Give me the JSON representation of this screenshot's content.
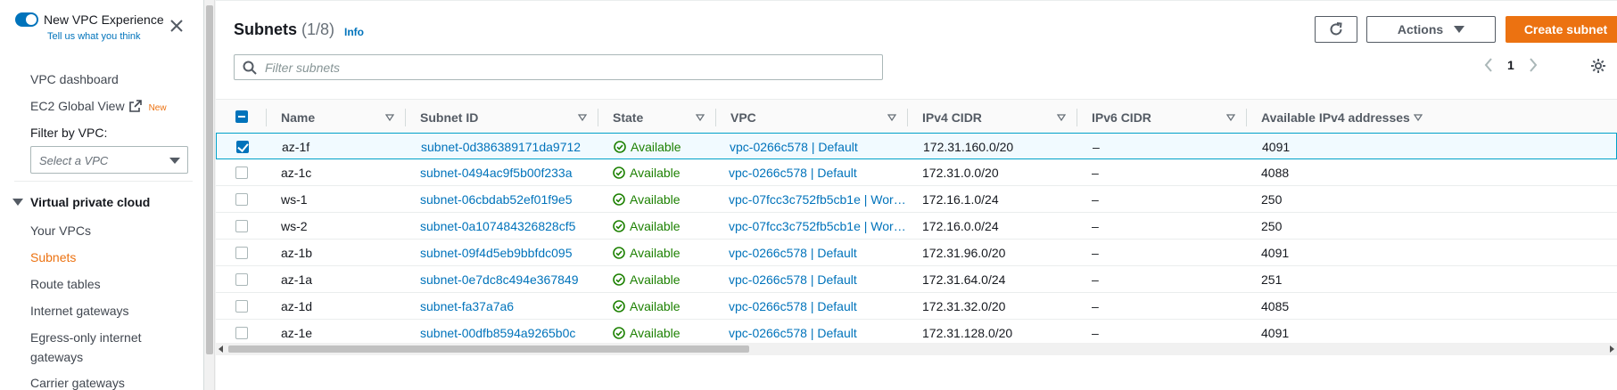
{
  "sidebar": {
    "toggle_label": "New VPC Experience",
    "feedback_link": "Tell us what you think",
    "nav": [
      {
        "label": "VPC dashboard"
      },
      {
        "label": "EC2 Global View",
        "badge": "New"
      }
    ],
    "filter_label": "Filter by VPC:",
    "filter_placeholder": "Select a VPC",
    "section_title": "Virtual private cloud",
    "section_items": [
      {
        "label": "Your VPCs"
      },
      {
        "label": "Subnets",
        "active": true
      },
      {
        "label": "Route tables"
      },
      {
        "label": "Internet gateways"
      },
      {
        "label": "Egress-only internet"
      },
      {
        "label": "gateways"
      },
      {
        "label": "Carrier gateways"
      }
    ]
  },
  "header": {
    "title": "Subnets",
    "count": "(1/8)",
    "info": "Info",
    "actions_label": "Actions",
    "create_label": "Create subnet"
  },
  "search": {
    "placeholder": "Filter subnets",
    "value": ""
  },
  "pagination": {
    "page": "1"
  },
  "table": {
    "columns": [
      "Name",
      "Subnet ID",
      "State",
      "VPC",
      "IPv4 CIDR",
      "IPv6 CIDR",
      "Available IPv4 addresses"
    ],
    "rows": [
      {
        "selected": true,
        "name": "az-1f",
        "subnet_id": "subnet-0d386389171da9712",
        "state": "Available",
        "vpc": "vpc-0266c578 | Default",
        "ipv4": "172.31.160.0/20",
        "ipv6": "–",
        "avail": "4091"
      },
      {
        "selected": false,
        "name": "az-1c",
        "subnet_id": "subnet-0494ac9f5b00f233a",
        "state": "Available",
        "vpc": "vpc-0266c578 | Default",
        "ipv4": "172.31.0.0/20",
        "ipv6": "–",
        "avail": "4088"
      },
      {
        "selected": false,
        "name": "ws-1",
        "subnet_id": "subnet-06cbdab52ef01f9e5",
        "state": "Available",
        "vpc": "vpc-07fcc3c752fb5cb1e | Wor…",
        "ipv4": "172.16.1.0/24",
        "ipv6": "–",
        "avail": "250"
      },
      {
        "selected": false,
        "name": "ws-2",
        "subnet_id": "subnet-0a107484326828cf5",
        "state": "Available",
        "vpc": "vpc-07fcc3c752fb5cb1e | Wor…",
        "ipv4": "172.16.0.0/24",
        "ipv6": "–",
        "avail": "250"
      },
      {
        "selected": false,
        "name": "az-1b",
        "subnet_id": "subnet-09f4d5eb9bbfdc095",
        "state": "Available",
        "vpc": "vpc-0266c578 | Default",
        "ipv4": "172.31.96.0/20",
        "ipv6": "–",
        "avail": "4091"
      },
      {
        "selected": false,
        "name": "az-1a",
        "subnet_id": "subnet-0e7dc8c494e367849",
        "state": "Available",
        "vpc": "vpc-0266c578 | Default",
        "ipv4": "172.31.64.0/24",
        "ipv6": "–",
        "avail": "251"
      },
      {
        "selected": false,
        "name": "az-1d",
        "subnet_id": "subnet-fa37a7a6",
        "state": "Available",
        "vpc": "vpc-0266c578 | Default",
        "ipv4": "172.31.32.0/20",
        "ipv6": "–",
        "avail": "4085"
      },
      {
        "selected": false,
        "name": "az-1e",
        "subnet_id": "subnet-00dfb8594a9265b0c",
        "state": "Available",
        "vpc": "vpc-0266c578 | Default",
        "ipv4": "172.31.128.0/20",
        "ipv6": "–",
        "avail": "4091"
      }
    ]
  },
  "colors": {
    "accent": "#ec7211",
    "link": "#0073bb",
    "success": "#1d8102"
  }
}
